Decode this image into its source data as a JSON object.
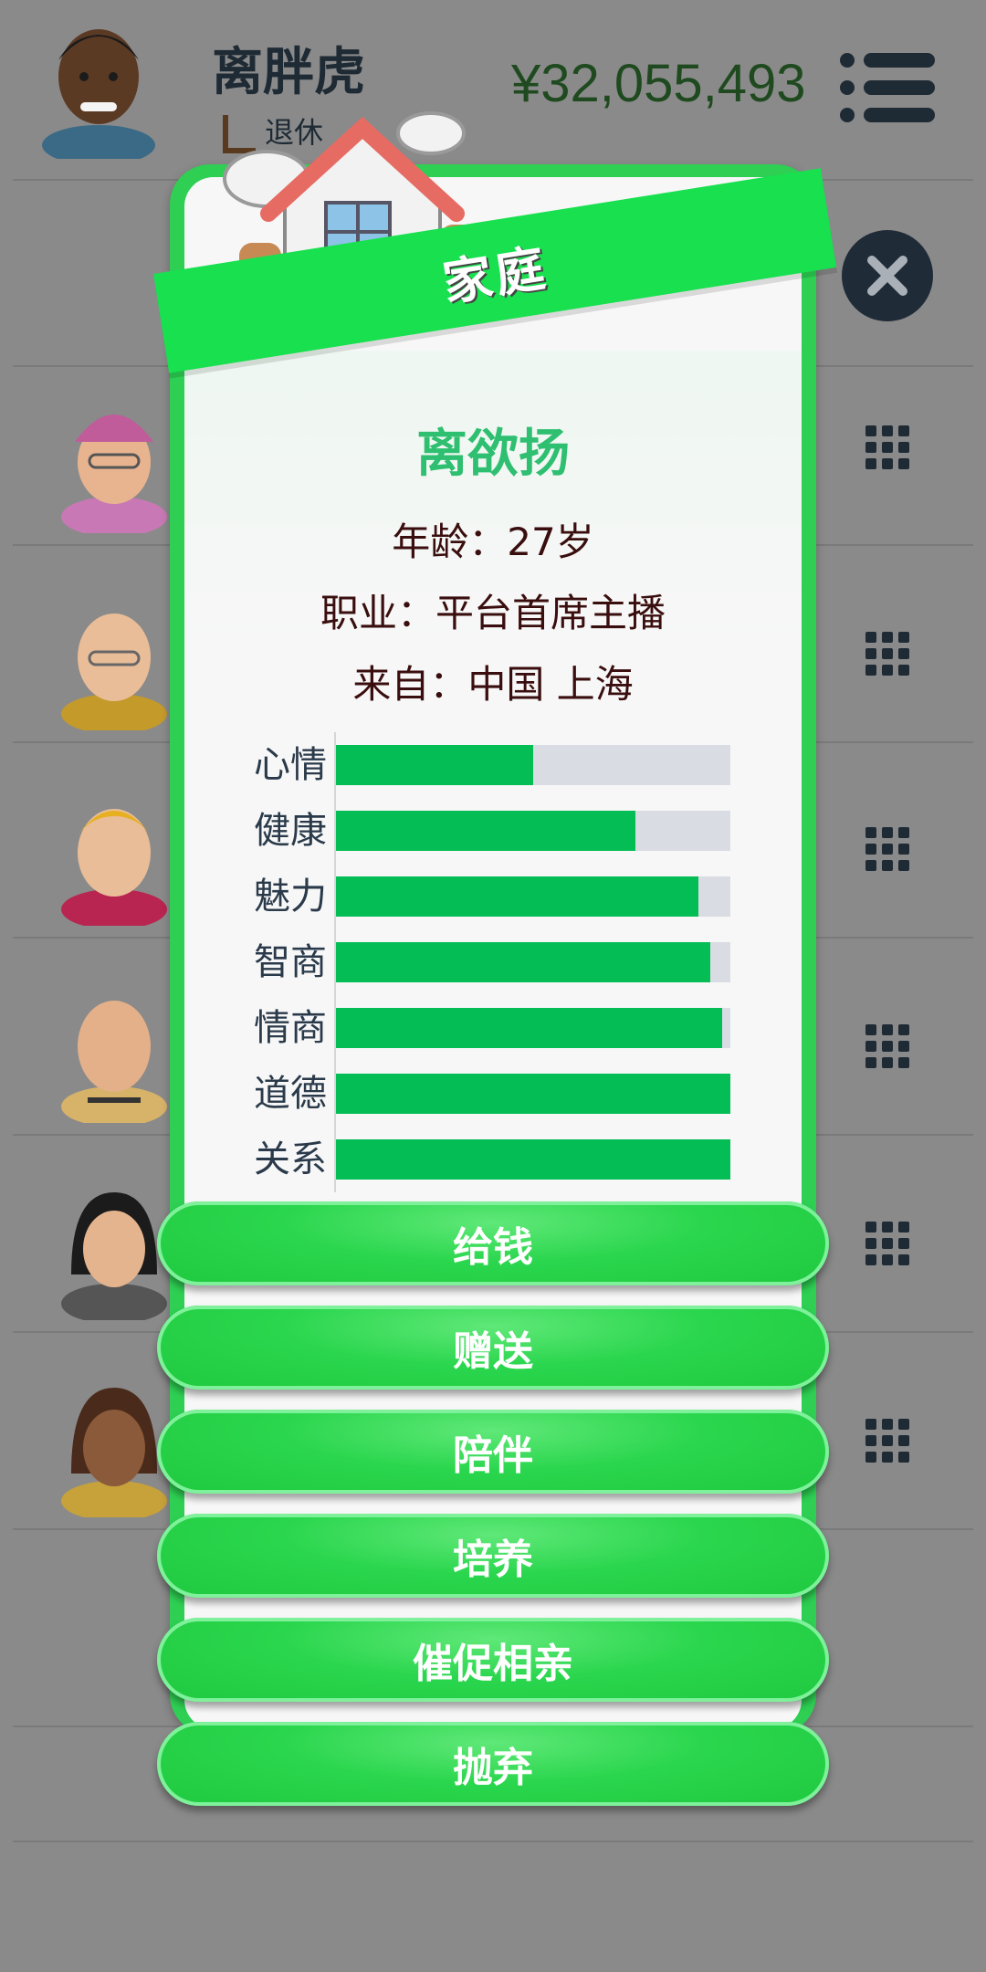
{
  "header": {
    "player_name": "离胖虎",
    "status": "退休",
    "money": "¥32,055,493",
    "menu_icon": "menu-icon"
  },
  "family_rows_icon": "grid-icon",
  "modal": {
    "title": "家庭",
    "person_name": "离欲扬",
    "age_line": "年龄：27岁",
    "job_line": "职业：平台首席主播",
    "origin_line": "来自：中国 上海",
    "stats": [
      {
        "label": "心情",
        "value": 0.5
      },
      {
        "label": "健康",
        "value": 0.76
      },
      {
        "label": "魅力",
        "value": 0.92
      },
      {
        "label": "智商",
        "value": 0.95
      },
      {
        "label": "情商",
        "value": 0.98
      },
      {
        "label": "道德",
        "value": 1.0
      },
      {
        "label": "关系",
        "value": 1.0
      }
    ],
    "actions": [
      "给钱",
      "赠送",
      "陪伴",
      "培养",
      "催促相亲",
      "抛弃"
    ]
  },
  "colors": {
    "bar_fill": "#05bd55",
    "bar_track": "#d9dde3",
    "accent_green": "#18e04f",
    "name_green": "#2fbf71",
    "money_green": "#1f4a1f"
  }
}
